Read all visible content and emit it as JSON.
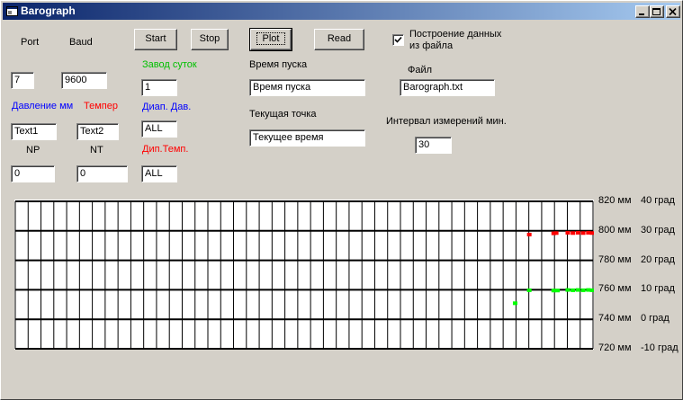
{
  "window": {
    "title": "Barograph"
  },
  "labels": {
    "port": "Port",
    "baud": "Baud",
    "pressure_mm": "Давление мм",
    "temper": "Темпер",
    "np": "NP",
    "nt": "NT",
    "zavod_sutok": "Завод суток",
    "diap_dav": "Диап. Дав.",
    "dip_temp": "Дип.Темп.",
    "start_time": "Время пуска",
    "current_point": "Текущая точка",
    "file": "Файл",
    "interval": "Интервал измерений мин.",
    "from_file": "Построение данных из  файла"
  },
  "fields": {
    "port": "7",
    "baud": "9600",
    "pressure": "Text1",
    "temper": "Text2",
    "np": "0",
    "nt": "0",
    "zavod_sutok": "1",
    "diap_dav": "ALL",
    "dip_temp": "ALL",
    "start_time": "Время пуска",
    "current_time": "Текущее время",
    "file": "Barograph.txt",
    "interval": "30"
  },
  "buttons": {
    "start": "Start",
    "stop": "Stop",
    "plot": "Plot",
    "read": "Read"
  },
  "checkbox": {
    "from_file_checked": true
  },
  "colors": {
    "pressure_series": "#ff0000",
    "temperature_series": "#00ff00",
    "titlebar_start": "#0a246a",
    "titlebar_end": "#a6caf0",
    "face": "#d4d0c8"
  },
  "chart_data": {
    "type": "scatter",
    "grid_columns": 45,
    "grid_rows": 5,
    "pressure_ticks": [
      "820 мм",
      "800 мм",
      "780 мм",
      "760 мм",
      "740 мм",
      "720 мм"
    ],
    "temperature_ticks": [
      "40 град",
      "30 град",
      "20 град",
      "10 град",
      "0 град",
      "-10 град"
    ],
    "ylim_pressure": [
      720,
      820
    ],
    "ylim_temperature": [
      -10,
      40
    ],
    "xlim": [
      0,
      45
    ],
    "series": [
      {
        "color": "#ff0000",
        "axis": "pressure",
        "points": [
          [
            40.0,
            797.8
          ],
          [
            41.9,
            798.6
          ],
          [
            42.1,
            798.8
          ],
          [
            43.0,
            799.0
          ],
          [
            43.4,
            798.8
          ],
          [
            43.8,
            799.0
          ],
          [
            44.2,
            798.8
          ],
          [
            44.6,
            799.0
          ],
          [
            44.9,
            798.8
          ]
        ]
      },
      {
        "color": "#00ff00",
        "axis": "temperature",
        "points": [
          [
            38.9,
            5.6
          ],
          [
            40.0,
            10.0
          ],
          [
            41.9,
            9.9
          ],
          [
            42.2,
            9.9
          ],
          [
            43.0,
            10.1
          ],
          [
            43.4,
            10.0
          ],
          [
            43.8,
            10.1
          ],
          [
            44.2,
            10.0
          ],
          [
            44.6,
            10.1
          ],
          [
            44.9,
            10.0
          ]
        ]
      }
    ]
  }
}
